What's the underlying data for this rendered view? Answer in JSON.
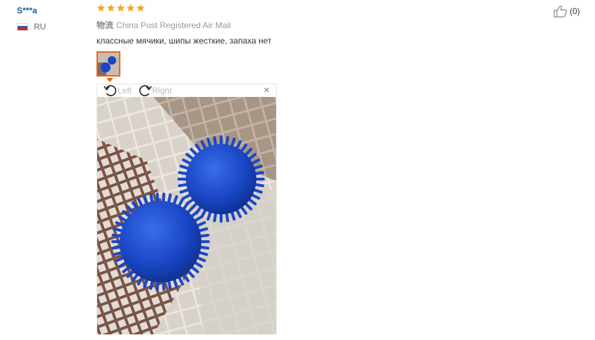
{
  "review": {
    "user_name": "S***a",
    "country_code": "RU",
    "rating": 5,
    "star_color": "#f5a623",
    "shipping_label": "物流",
    "shipping_method": "China Post Registered Air Mail",
    "text": "классные мячики, шипы жесткие, запаха нет",
    "helpful_count": "(0)"
  },
  "viewer": {
    "rotate_left_label": "Left",
    "rotate_right_label": "Right",
    "close_label": "×"
  },
  "colors": {
    "accent": "#e46a1a",
    "link": "#1e5a99",
    "ball": "#1a47c6"
  }
}
